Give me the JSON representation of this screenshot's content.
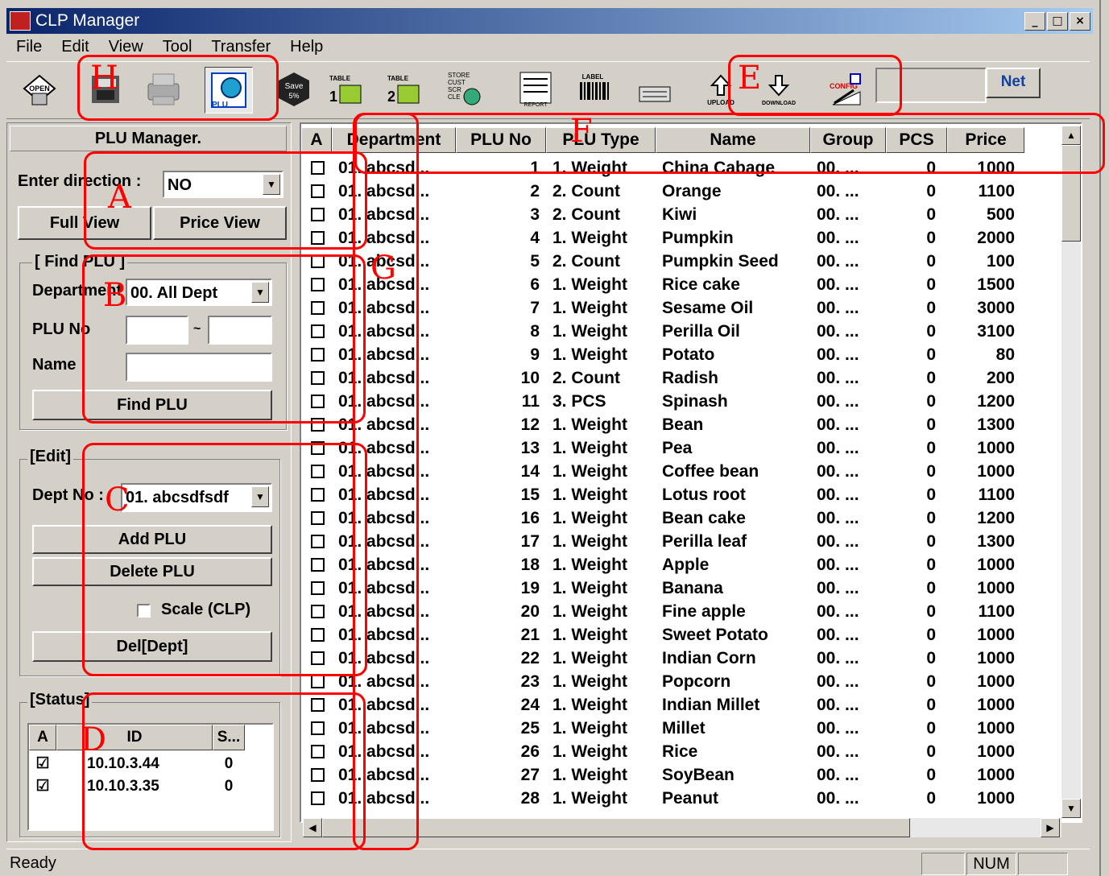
{
  "window": {
    "title": "CLP Manager",
    "min": "_",
    "max": "□",
    "close": "×"
  },
  "menu": [
    "File",
    "Edit",
    "View",
    "Tool",
    "Transfer",
    "Help"
  ],
  "toolbar": {
    "net_label": "Net"
  },
  "left": {
    "title": "PLU Manager.",
    "enter_direction_label": "Enter direction :",
    "enter_direction_value": "NO",
    "full_view": "Full View",
    "price_view": "Price View",
    "find_group": "[ Find PLU ]",
    "department_label": "Department",
    "department_value": "00. All Dept",
    "plu_no_label": "PLU No",
    "range_sep": "~",
    "name_label": "Name",
    "find_btn": "Find PLU",
    "edit_group": "[Edit]",
    "dept_no_label": "Dept No :",
    "dept_no_value": "01. abcsdfsdf",
    "add_btn": "Add PLU",
    "delete_btn": "Delete PLU",
    "scale_label": "Scale (CLP)",
    "del_dept_btn": "Del[Dept]",
    "status_group": "[Status]",
    "status_headers": [
      "A",
      "ID",
      "S..."
    ],
    "status_rows": [
      {
        "checked": "☑",
        "id": "10.10.3.44",
        "s": "0"
      },
      {
        "checked": "☑",
        "id": "10.10.3.35",
        "s": "0"
      }
    ]
  },
  "grid": {
    "headers": [
      "A",
      "Department",
      "PLU No",
      "PLU Type",
      "Name",
      "Group",
      "PCS",
      "Price"
    ],
    "rows": [
      {
        "dept": "01. abcsd...",
        "no": "1",
        "type": "1. Weight",
        "name": "China Cabage",
        "group": "00. ...",
        "pcs": "0",
        "price": "1000"
      },
      {
        "dept": "01. abcsd...",
        "no": "2",
        "type": "2. Count",
        "name": "Orange",
        "group": "00. ...",
        "pcs": "0",
        "price": "1100"
      },
      {
        "dept": "01. abcsd...",
        "no": "3",
        "type": "2. Count",
        "name": "Kiwi",
        "group": "00. ...",
        "pcs": "0",
        "price": "500"
      },
      {
        "dept": "01. abcsd...",
        "no": "4",
        "type": "1. Weight",
        "name": "Pumpkin",
        "group": "00. ...",
        "pcs": "0",
        "price": "2000"
      },
      {
        "dept": "01. abcsd...",
        "no": "5",
        "type": "2. Count",
        "name": "Pumpkin Seed",
        "group": "00. ...",
        "pcs": "0",
        "price": "100"
      },
      {
        "dept": "01. abcsd...",
        "no": "6",
        "type": "1. Weight",
        "name": "Rice cake",
        "group": "00. ...",
        "pcs": "0",
        "price": "1500"
      },
      {
        "dept": "01. abcsd...",
        "no": "7",
        "type": "1. Weight",
        "name": "Sesame Oil",
        "group": "00. ...",
        "pcs": "0",
        "price": "3000"
      },
      {
        "dept": "01. abcsd...",
        "no": "8",
        "type": "1. Weight",
        "name": "Perilla Oil",
        "group": "00. ...",
        "pcs": "0",
        "price": "3100"
      },
      {
        "dept": "01. abcsd...",
        "no": "9",
        "type": "1. Weight",
        "name": "Potato",
        "group": "00. ...",
        "pcs": "0",
        "price": "80"
      },
      {
        "dept": "01. abcsd...",
        "no": "10",
        "type": "2. Count",
        "name": "Radish",
        "group": "00. ...",
        "pcs": "0",
        "price": "200"
      },
      {
        "dept": "01. abcsd...",
        "no": "11",
        "type": "3. PCS",
        "name": "Spinash",
        "group": "00. ...",
        "pcs": "0",
        "price": "1200"
      },
      {
        "dept": "01. abcsd...",
        "no": "12",
        "type": "1. Weight",
        "name": "Bean",
        "group": "00. ...",
        "pcs": "0",
        "price": "1300"
      },
      {
        "dept": "01. abcsd...",
        "no": "13",
        "type": "1. Weight",
        "name": "Pea",
        "group": "00. ...",
        "pcs": "0",
        "price": "1000"
      },
      {
        "dept": "01. abcsd...",
        "no": "14",
        "type": "1. Weight",
        "name": "Coffee bean",
        "group": "00. ...",
        "pcs": "0",
        "price": "1000"
      },
      {
        "dept": "01. abcsd...",
        "no": "15",
        "type": "1. Weight",
        "name": "Lotus root",
        "group": "00. ...",
        "pcs": "0",
        "price": "1100"
      },
      {
        "dept": "01. abcsd...",
        "no": "16",
        "type": "1. Weight",
        "name": "Bean cake",
        "group": "00. ...",
        "pcs": "0",
        "price": "1200"
      },
      {
        "dept": "01. abcsd...",
        "no": "17",
        "type": "1. Weight",
        "name": "Perilla leaf",
        "group": "00. ...",
        "pcs": "0",
        "price": "1300"
      },
      {
        "dept": "01. abcsd...",
        "no": "18",
        "type": "1. Weight",
        "name": "Apple",
        "group": "00. ...",
        "pcs": "0",
        "price": "1000"
      },
      {
        "dept": "01. abcsd...",
        "no": "19",
        "type": "1. Weight",
        "name": "Banana",
        "group": "00. ...",
        "pcs": "0",
        "price": "1000"
      },
      {
        "dept": "01. abcsd...",
        "no": "20",
        "type": "1. Weight",
        "name": "Fine apple",
        "group": "00. ...",
        "pcs": "0",
        "price": "1100"
      },
      {
        "dept": "01. abcsd...",
        "no": "21",
        "type": "1. Weight",
        "name": "Sweet Potato",
        "group": "00. ...",
        "pcs": "0",
        "price": "1000"
      },
      {
        "dept": "01. abcsd...",
        "no": "22",
        "type": "1. Weight",
        "name": "Indian Corn",
        "group": "00. ...",
        "pcs": "0",
        "price": "1000"
      },
      {
        "dept": "01. abcsd...",
        "no": "23",
        "type": "1. Weight",
        "name": "Popcorn",
        "group": "00. ...",
        "pcs": "0",
        "price": "1000"
      },
      {
        "dept": "01. abcsd...",
        "no": "24",
        "type": "1. Weight",
        "name": "Indian Millet",
        "group": "00. ...",
        "pcs": "0",
        "price": "1000"
      },
      {
        "dept": "01. abcsd...",
        "no": "25",
        "type": "1. Weight",
        "name": "Millet",
        "group": "00. ...",
        "pcs": "0",
        "price": "1000"
      },
      {
        "dept": "01. abcsd...",
        "no": "26",
        "type": "1. Weight",
        "name": "Rice",
        "group": "00. ...",
        "pcs": "0",
        "price": "1000"
      },
      {
        "dept": "01. abcsd...",
        "no": "27",
        "type": "1. Weight",
        "name": "SoyBean",
        "group": "00. ...",
        "pcs": "0",
        "price": "1000"
      },
      {
        "dept": "01. abcsd...",
        "no": "28",
        "type": "1. Weight",
        "name": "Peanut",
        "group": "00. ...",
        "pcs": "0",
        "price": "1000"
      }
    ]
  },
  "status": {
    "text": "Ready",
    "num": "NUM"
  },
  "annotations": [
    "A",
    "B",
    "C",
    "D",
    "E",
    "F",
    "G",
    "H"
  ],
  "tool_labels": {
    "open": "OPEN",
    "plu": "PLU",
    "save": "Save",
    "save_pct": "5%",
    "table1": "TABLE",
    "table1_n": "1",
    "table2": "TABLE",
    "table2_n": "2",
    "store1": "STORE",
    "store2": "CUST",
    "store3": "SCR",
    "store4": "CLE",
    "report": "REPORT",
    "label": "LABEL",
    "upload": "UPLOAD",
    "download": "DOWNLOAD",
    "config": "CONFIG"
  },
  "colors": {
    "annotation": "#ff0000",
    "titlebar": "#0a246a"
  }
}
